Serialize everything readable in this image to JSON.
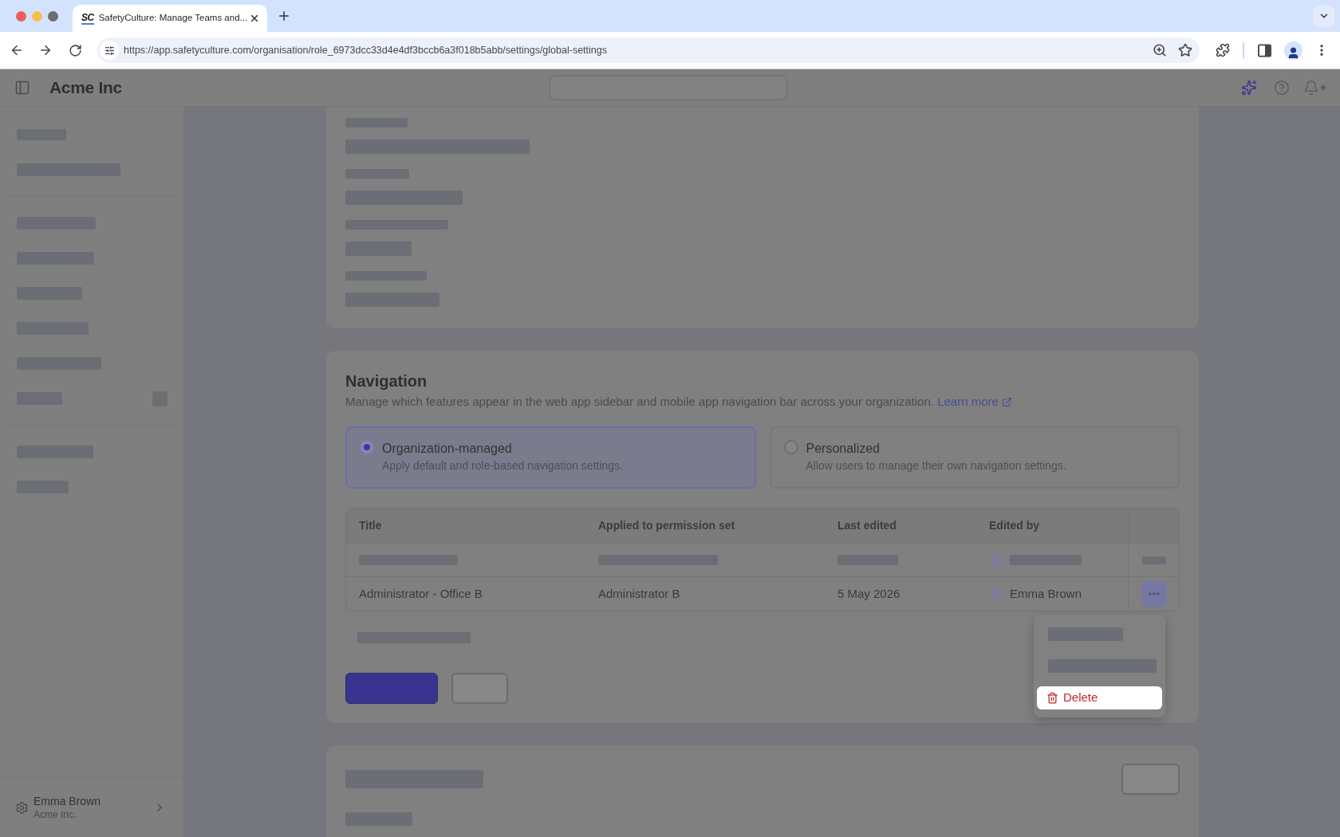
{
  "browser": {
    "tab": {
      "favicon": "SC",
      "title": "SafetyCulture: Manage Teams and...",
      "selected": true
    },
    "url": "https://app.safetyculture.com/organisation/role_6973dcc33d4e4df3bccb6a3f018b5abb/settings/global-settings"
  },
  "header": {
    "brand": "Acme Inc"
  },
  "sidebar": {
    "sections": [
      {
        "items": [
          {
            "kind": "placeholder"
          },
          {
            "kind": "placeholder"
          }
        ]
      },
      {
        "items": [
          {
            "kind": "placeholder"
          },
          {
            "kind": "placeholder"
          },
          {
            "kind": "placeholder"
          },
          {
            "kind": "placeholder"
          },
          {
            "kind": "placeholder"
          },
          {
            "kind": "placeholder_badge"
          }
        ]
      },
      {
        "items": [
          {
            "kind": "placeholder"
          },
          {
            "kind": "placeholder"
          }
        ]
      }
    ],
    "user": {
      "name": "Emma Brown",
      "org": "Acme Inc."
    }
  },
  "cards": [
    {
      "kind": "placeholder_fields",
      "fields": [
        {
          "kind": "placeholder"
        },
        {
          "kind": "placeholder"
        },
        {
          "kind": "placeholder"
        },
        {
          "kind": "placeholder"
        }
      ]
    },
    {
      "kind": "navigation",
      "title": "Navigation",
      "description": "Manage which features appear in the web app sidebar and mobile app navigation bar across your organization.",
      "link": "Learn more",
      "options": [
        {
          "title": "Organization-managed",
          "description": "Apply default and role-based navigation settings.",
          "selected": true
        },
        {
          "title": "Personalized",
          "description": "Allow users to manage their own navigation settings.",
          "selected": false
        }
      ],
      "table": {
        "columns": [
          "Title",
          "Applied to permission set",
          "Last edited",
          "Edited by"
        ],
        "rows": [
          {
            "kind": "placeholder"
          },
          {
            "kind": "entry",
            "title": "Administrator - Office B",
            "permission_set": "Administrator B",
            "last_edited": "5 May 2026",
            "edited_by": "Emma Brown",
            "menu_open": true,
            "menu": {
              "items": [
                {
                  "kind": "placeholder"
                },
                {
                  "kind": "placeholder"
                },
                {
                  "kind": "action",
                  "label": "Delete",
                  "highlighted": true
                }
              ]
            }
          }
        ]
      },
      "note": {
        "kind": "placeholder"
      },
      "buttons": [
        {
          "kind": "primary"
        },
        {
          "kind": "secondary"
        }
      ]
    },
    {
      "kind": "placeholder_section"
    }
  ]
}
